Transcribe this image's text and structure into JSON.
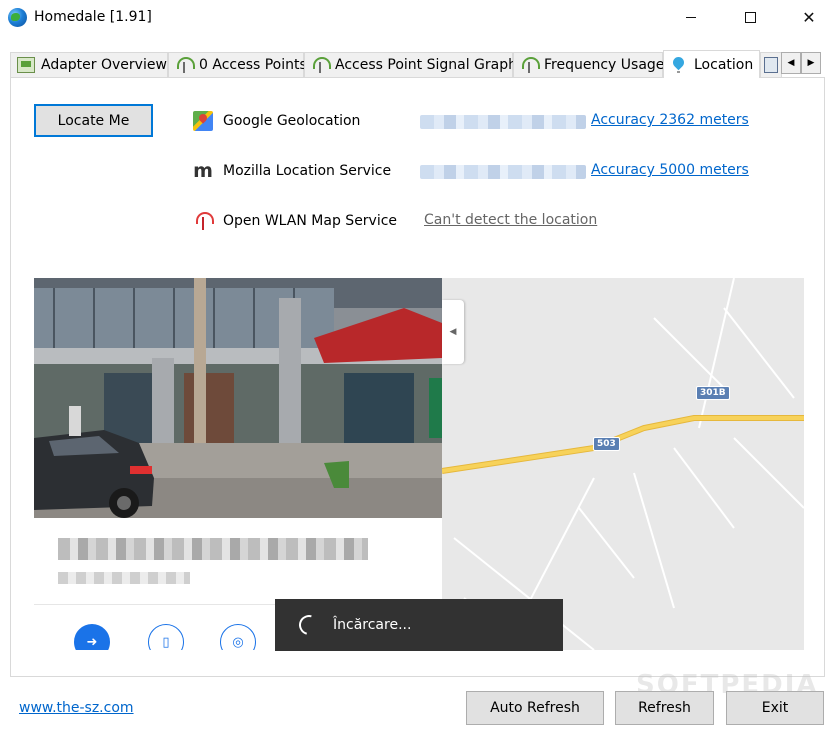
{
  "window": {
    "title": "Homedale [1.91]"
  },
  "tabs": [
    {
      "label": "Adapter Overview",
      "icon": "adapter-icon"
    },
    {
      "label": "0 Access Points",
      "icon": "antenna-icon"
    },
    {
      "label": "Access Point Signal Graph",
      "icon": "antenna-icon"
    },
    {
      "label": "Frequency Usage",
      "icon": "antenna-icon"
    },
    {
      "label": "Location",
      "icon": "location-pin-icon",
      "active": true
    }
  ],
  "location": {
    "locate_button": "Locate Me",
    "services": [
      {
        "name": "Google Geolocation",
        "result": "Accuracy 2362 meters"
      },
      {
        "name": "Mozilla Location Service",
        "result": "Accuracy 5000 meters"
      },
      {
        "name": "Open WLAN Map Service",
        "result": "Can't detect the location"
      }
    ],
    "mozilla_icon_letter": "m"
  },
  "map": {
    "road_labels": [
      "301B",
      "503"
    ],
    "loading_text": "Încărcare...",
    "road_color": "#f7d25a",
    "accent": "#1a73e8"
  },
  "footer": {
    "website": "www.the-sz.com",
    "auto_refresh": "Auto Refresh",
    "refresh": "Refresh",
    "exit": "Exit"
  },
  "watermark": "SOFTPEDIA"
}
